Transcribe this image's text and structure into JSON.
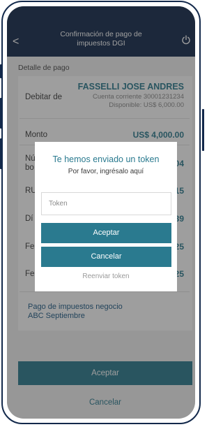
{
  "header": {
    "title_line1": "Confirmación de pago de",
    "title_line2": "impuestos DGI",
    "back_icon": "<"
  },
  "section_label": "Detalle de pago",
  "debit": {
    "label": "Debitar de",
    "account_name": "FASSELLI JOSE ANDRES",
    "account_line": "Cuenta corriente  30001231234",
    "available_line": "Disponible: US$ 6,000.00"
  },
  "rows": [
    {
      "label": "Monto",
      "value": "US$ 4,000.00"
    },
    {
      "label": "Nú",
      "value": "04"
    },
    {
      "label": "bo",
      "value": ""
    },
    {
      "label": "RU",
      "value": "15"
    },
    {
      "label": "Dí",
      "value": "39"
    },
    {
      "label": "Fe",
      "value": "25"
    },
    {
      "label": "Fe",
      "value": "25"
    }
  ],
  "concept": {
    "line1": "Pago de impuestos negocio",
    "line2": "ABC Septiembre"
  },
  "buttons": {
    "accept": "Aceptar",
    "cancel": "Cancelar"
  },
  "modal": {
    "title": "Te hemos enviado un token",
    "subtitle": "Por favor, ingrésalo aquí",
    "token_placeholder": "Token",
    "token_value": "",
    "accept": "Aceptar",
    "cancel": "Cancelar",
    "resend": "Reenviar token"
  },
  "colors": {
    "navy": "#13294b",
    "teal": "#2a7a8f",
    "link_blue": "#1d5a85"
  }
}
